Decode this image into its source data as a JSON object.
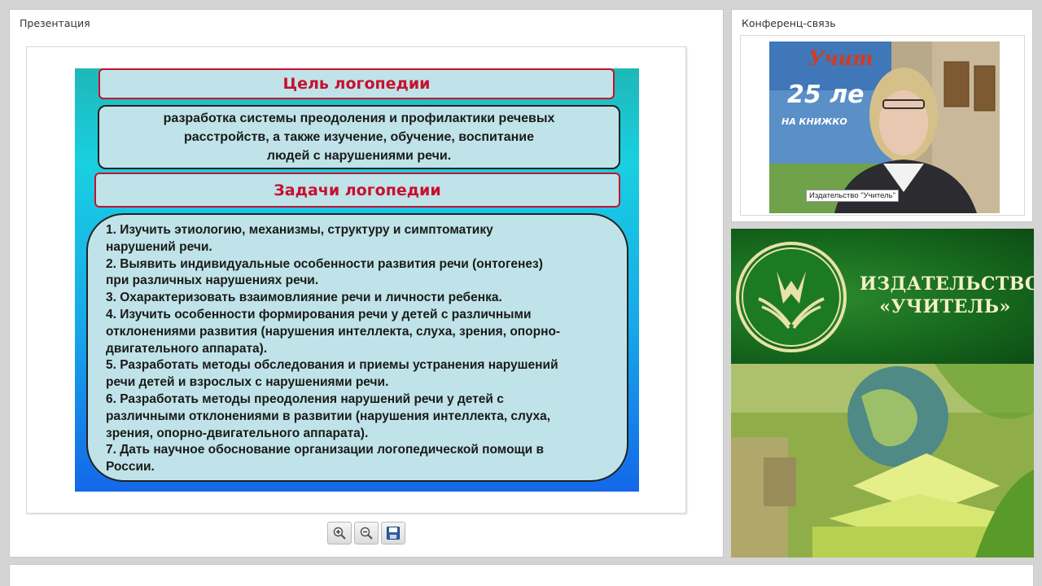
{
  "presentation": {
    "title": "Презентация",
    "slide": {
      "goal_title": "Цель логопедии",
      "goal_lines": [
        "разработка системы преодоления и профилактики речевых",
        "расстройств, а также изучение, обучение, воспитание",
        "людей с нарушениями речи."
      ],
      "tasks_title": "Задачи логопедии",
      "task_lines": [
        "1. Изучить этиологию, механизмы, структуру и симптоматику",
        "нарушений речи.",
        "2. Выявить индивидуальные особенности развития речи (онтогенез)",
        "при различных нарушениях речи.",
        "3. Охарактеризовать взаимовлияние речи и личности ребенка.",
        "4. Изучить особенности формирования речи у детей с различными",
        "отклонениями развития (нарушения интеллекта, слуха, зрения, опорно-",
        "двигательного аппарата).",
        "5. Разработать методы обследования и приемы устранения нарушений",
        "речи детей и взрослых с нарушениями речи.",
        "6. Разработать методы преодоления нарушений речи у детей с",
        "различными отклонениями в развитии (нарушения интеллекта, слуха,",
        "зрения, опорно-двигательного аппарата).",
        "7. Дать научное обоснование организации логопедической помощи в",
        "России."
      ]
    },
    "toolbar": [
      {
        "name": "zoom-in-button",
        "icon": "zoom-in-icon"
      },
      {
        "name": "zoom-out-button",
        "icon": "zoom-out-icon"
      },
      {
        "name": "save-button",
        "icon": "floppy-disk-icon"
      }
    ]
  },
  "conference": {
    "title": "Конференц-связь",
    "video_label": "Издательство \"Учитель\"",
    "background_sign": {
      "line1": "Учит",
      "line2": "25 ле",
      "line3": "НА КНИЖКО"
    }
  },
  "publisher": {
    "name_line1": "ИЗДАТЕЛЬСТВО",
    "name_line2": "«УЧИТЕЛЬ»",
    "colors": {
      "green_dark": "#0d4c14",
      "green": "#176a1e",
      "cream": "#f3f0c8"
    }
  }
}
